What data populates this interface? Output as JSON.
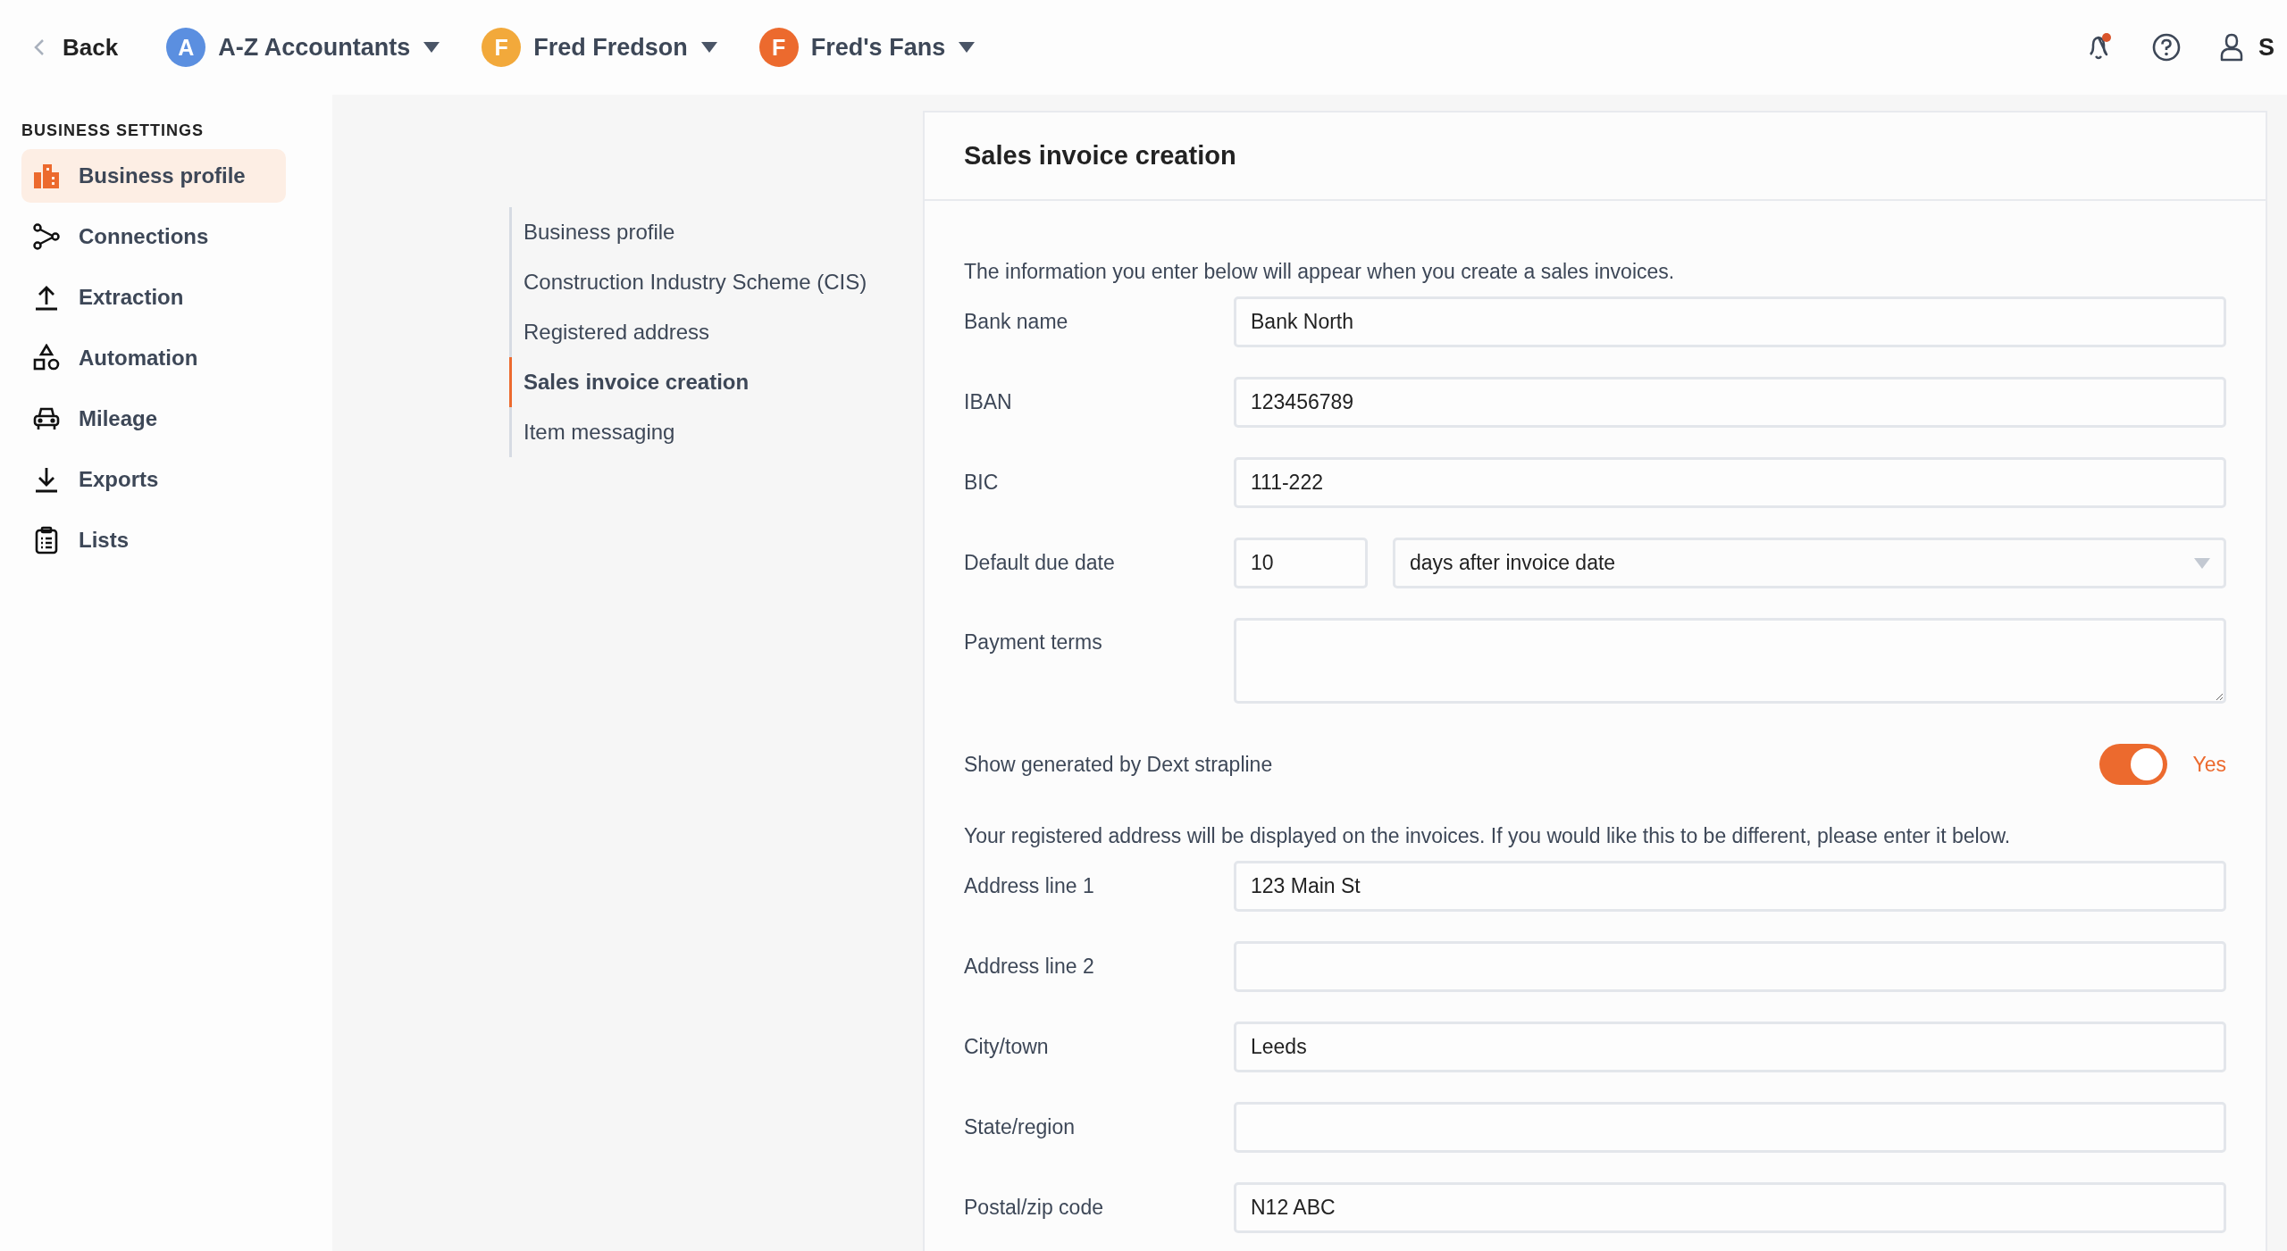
{
  "top_bar": {
    "back": "Back",
    "switchers": [
      {
        "initial": "A",
        "name": "A-Z Accountants",
        "color": "#5b8fe0"
      },
      {
        "initial": "F",
        "name": "Fred Fredson",
        "color": "#f2a93b"
      },
      {
        "initial": "F",
        "name": "Fred's Fans",
        "color": "#ec6a2e"
      }
    ],
    "notifications_unread": true,
    "user_label": "S"
  },
  "sidebar": {
    "heading": "BUSINESS SETTINGS",
    "items": [
      {
        "label": "Business profile",
        "selected": true
      },
      {
        "label": "Connections",
        "selected": false
      },
      {
        "label": "Extraction",
        "selected": false
      },
      {
        "label": "Automation",
        "selected": false
      },
      {
        "label": "Mileage",
        "selected": false
      },
      {
        "label": "Exports",
        "selected": false
      },
      {
        "label": "Lists",
        "selected": false
      }
    ]
  },
  "section_nav": [
    {
      "label": "Business profile",
      "selected": false
    },
    {
      "label": "Construction Industry Scheme (CIS)",
      "selected": false
    },
    {
      "label": "Registered address",
      "selected": false
    },
    {
      "label": "Sales invoice creation",
      "selected": true
    },
    {
      "label": "Item messaging",
      "selected": false
    }
  ],
  "panel": {
    "title": "Sales invoice creation",
    "rows": [
      {
        "kind": "note",
        "text": "The information you enter below will appear when you create a sales invoices."
      },
      {
        "kind": "text",
        "label": "Bank name",
        "value": "Bank North"
      },
      {
        "kind": "text",
        "label": "IBAN",
        "value": "123456789"
      },
      {
        "kind": "text",
        "label": "BIC",
        "value": "111-222"
      },
      {
        "kind": "due",
        "label": "Default due date",
        "value": "10",
        "option": "days after invoice date"
      },
      {
        "kind": "textarea",
        "label": "Payment terms"
      },
      {
        "kind": "toggle",
        "label": "Show generated by Dext strapline",
        "on": true,
        "state_text": "Yes"
      },
      {
        "kind": "note",
        "text": "Your registered address will be displayed on the invoices. If you would like this to be different, please enter it below."
      },
      {
        "kind": "text",
        "label": "Address line 1",
        "value": "123 Main St"
      },
      {
        "kind": "text",
        "label": "Address line 2",
        "value": ""
      },
      {
        "kind": "text",
        "label": "City/town",
        "value": "Leeds"
      },
      {
        "kind": "text",
        "label": "State/region",
        "value": ""
      },
      {
        "kind": "text",
        "label": "Postal/zip code",
        "value": "N12 ABC"
      }
    ]
  }
}
